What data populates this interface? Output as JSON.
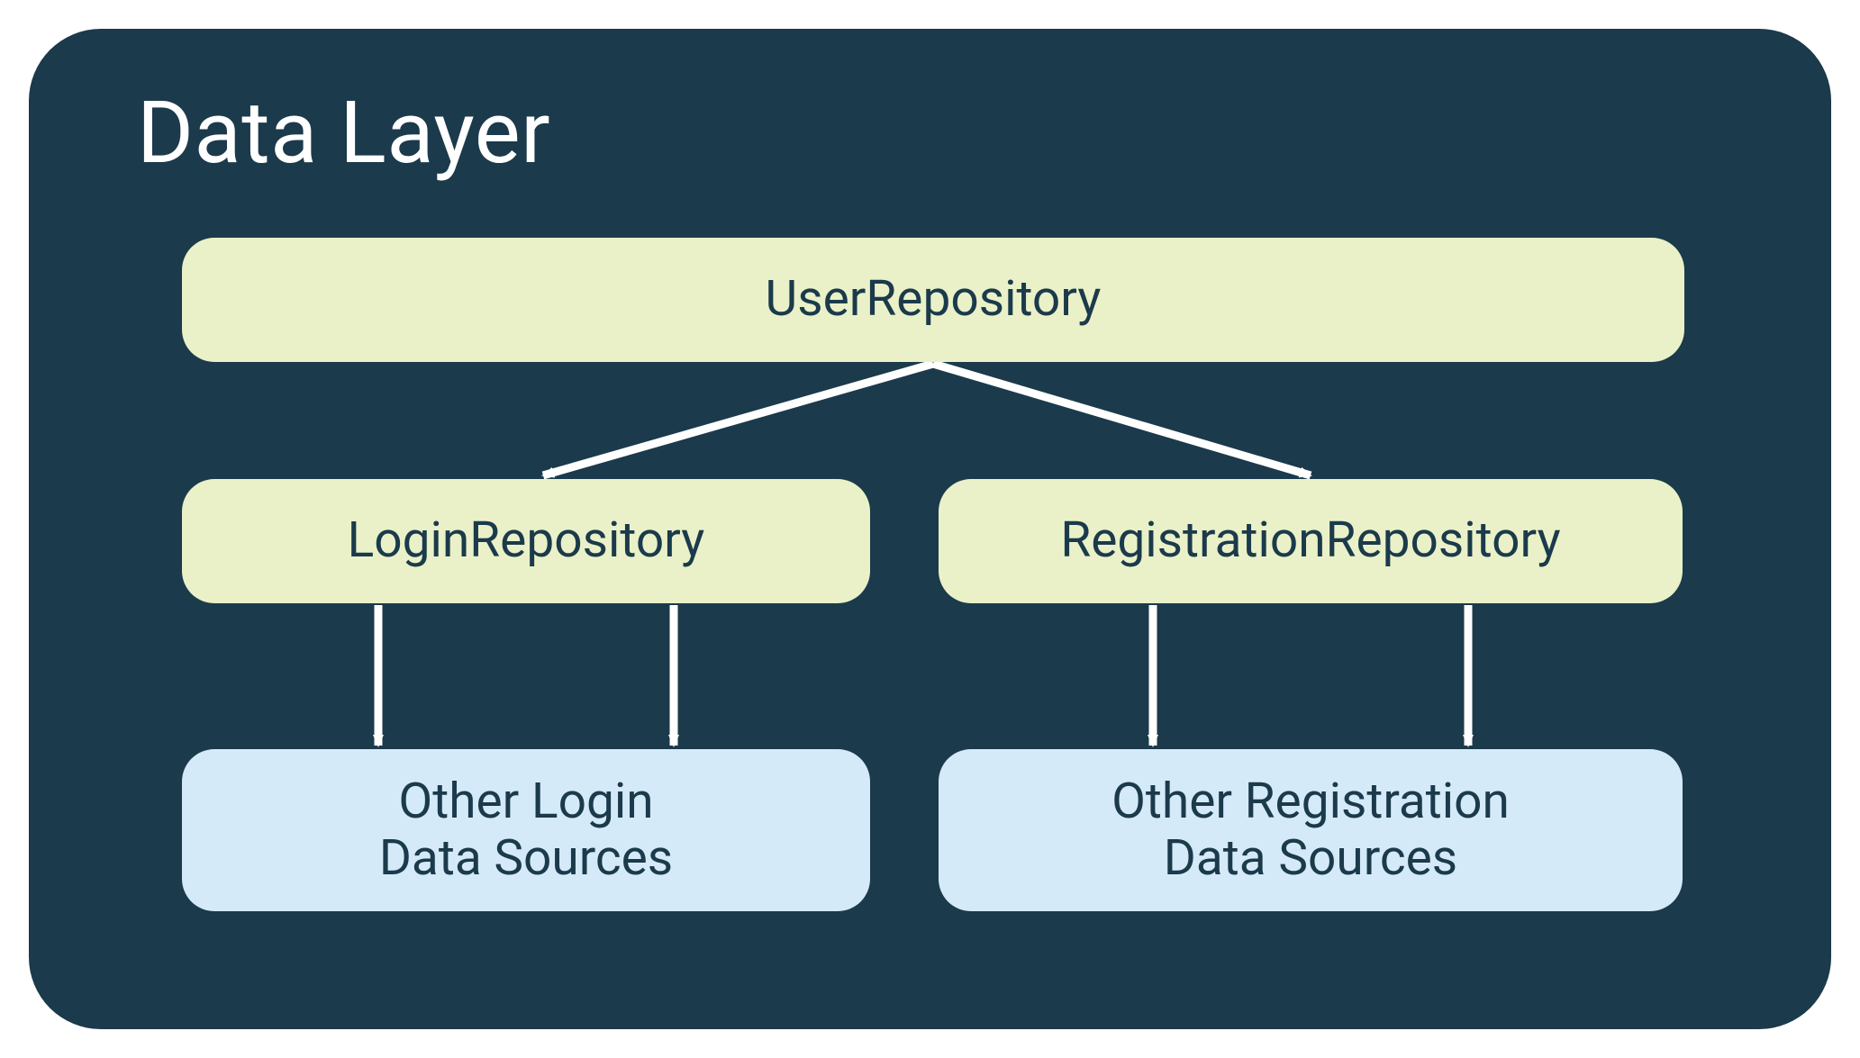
{
  "title": "Data Layer",
  "nodes": {
    "user_repository": "UserRepository",
    "login_repository": "LoginRepository",
    "registration_repository": "RegistrationRepository",
    "login_data_sources": "Other Login\nData Sources",
    "registration_data_sources": "Other Registration\nData Sources"
  },
  "colors": {
    "container_bg": "#1b3a4b",
    "repo_bg": "#eaf1c8",
    "datasource_bg": "#d5eaf8",
    "arrow": "#ffffff",
    "text_dark": "#1b3a4b",
    "text_light": "#ffffff"
  },
  "chart_data": {
    "type": "diagram",
    "title": "Data Layer",
    "nodes": [
      {
        "id": "user_repository",
        "label": "UserRepository",
        "kind": "repository"
      },
      {
        "id": "login_repository",
        "label": "LoginRepository",
        "kind": "repository"
      },
      {
        "id": "registration_repository",
        "label": "RegistrationRepository",
        "kind": "repository"
      },
      {
        "id": "login_data_sources",
        "label": "Other Login Data Sources",
        "kind": "datasource"
      },
      {
        "id": "registration_data_sources",
        "label": "Other Registration Data Sources",
        "kind": "datasource"
      }
    ],
    "edges": [
      {
        "from": "user_repository",
        "to": "login_repository"
      },
      {
        "from": "user_repository",
        "to": "registration_repository"
      },
      {
        "from": "login_repository",
        "to": "login_data_sources"
      },
      {
        "from": "login_repository",
        "to": "login_data_sources"
      },
      {
        "from": "registration_repository",
        "to": "registration_data_sources"
      },
      {
        "from": "registration_repository",
        "to": "registration_data_sources"
      }
    ]
  }
}
